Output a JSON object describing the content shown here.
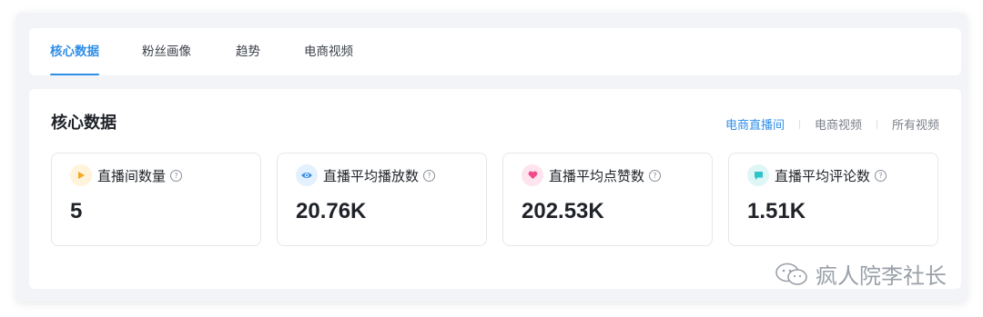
{
  "tabs": [
    "核心数据",
    "粉丝画像",
    "趋势",
    "电商视频"
  ],
  "panel": {
    "title": "核心数据",
    "filters": [
      "电商直播间",
      "电商视频",
      "所有视频"
    ]
  },
  "cards": [
    {
      "label": "直播间数量",
      "value": "5",
      "icon": "play-icon",
      "color": "#f5a623"
    },
    {
      "label": "直播平均播放数",
      "value": "20.76K",
      "icon": "eye-icon",
      "color": "#3a8ee6"
    },
    {
      "label": "直播平均点赞数",
      "value": "202.53K",
      "icon": "heart-icon",
      "color": "#ef4b8a"
    },
    {
      "label": "直播平均评论数",
      "value": "1.51K",
      "icon": "comment-icon",
      "color": "#2fc4c8"
    }
  ],
  "watermark": "疯人院李社长"
}
